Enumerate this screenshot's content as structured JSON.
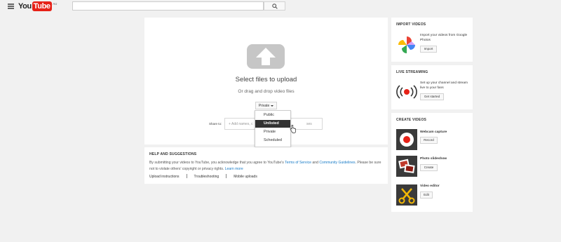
{
  "masthead": {
    "logo_you": "You",
    "logo_tube": "Tube",
    "logo_region": "AU",
    "search_placeholder": ""
  },
  "upload": {
    "title": "Select files to upload",
    "subtitle": "Or drag and drop video files",
    "privacy_selected": "Private",
    "share_label": "Share to:",
    "share_placeholder": "+ Add names, c",
    "share_placeholder_tail": "ses",
    "dropdown_options": [
      "Public",
      "Unlisted",
      "Private",
      "Scheduled"
    ],
    "highlighted_option": "Unlisted"
  },
  "help": {
    "title": "HELP AND SUGGESTIONS",
    "text_1": "By submitting your videos to YouTube, you acknowledge that you agree to YouTube's ",
    "tos_link": "Terms of Service",
    "text_and": " and ",
    "guidelines_link": "Community Guidelines",
    "text_2": ". Please be sure not to violate others' copyright or privacy rights. ",
    "learn_more": "Learn more",
    "links": [
      "Upload instructions",
      "Troubleshooting",
      "Mobile uploads"
    ]
  },
  "sidebar": {
    "import": {
      "title": "IMPORT VIDEOS",
      "description": "Import your videos from Google Photos",
      "button": "Import",
      "icon": "google-photos-icon"
    },
    "live": {
      "title": "LIVE STREAMING",
      "description": "Set up your channel and stream live to your fans",
      "button": "Get started",
      "icon": "live-broadcast-icon"
    },
    "create": {
      "title": "CREATE VIDEOS",
      "items": [
        {
          "label": "Webcam capture",
          "button": "Record",
          "icon": "webcam-record-icon"
        },
        {
          "label": "Photo slideshow",
          "button": "Create",
          "icon": "photo-slideshow-icon"
        },
        {
          "label": "Video editor",
          "button": "Edit",
          "icon": "scissors-icon"
        }
      ]
    }
  },
  "colors": {
    "brand_red": "#e62117",
    "link_blue": "#167ac6",
    "page_bg": "#f1f1f1"
  }
}
